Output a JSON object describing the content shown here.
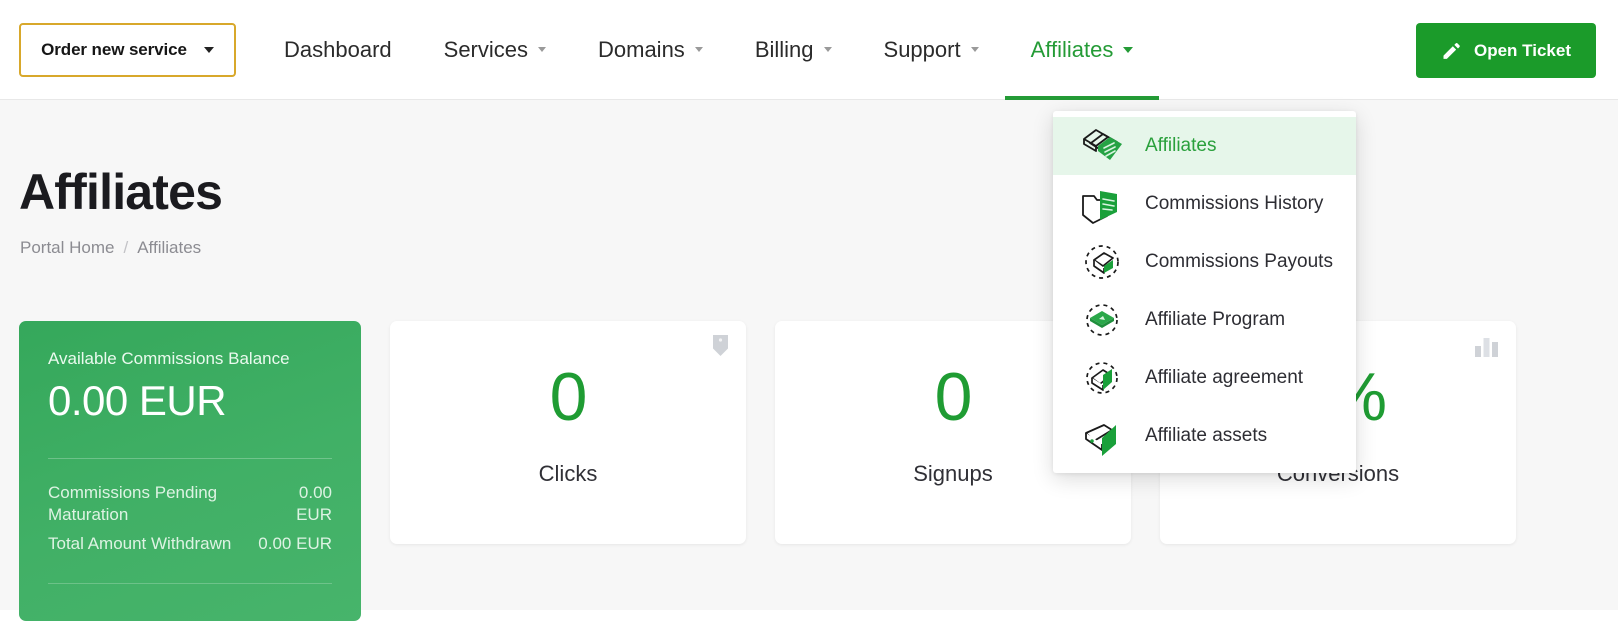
{
  "navbar": {
    "order_button": {
      "label": "Order new service",
      "caret_icon": "chevron-down-icon"
    },
    "items": [
      {
        "label": "Dashboard",
        "has_caret": false,
        "active": false
      },
      {
        "label": "Services",
        "has_caret": true,
        "active": false
      },
      {
        "label": "Domains",
        "has_caret": true,
        "active": false
      },
      {
        "label": "Billing",
        "has_caret": true,
        "active": false
      },
      {
        "label": "Support",
        "has_caret": true,
        "active": false
      },
      {
        "label": "Affiliates",
        "has_caret": true,
        "active": true
      }
    ],
    "open_ticket": {
      "label": "Open Ticket",
      "icon": "pencil-icon"
    }
  },
  "dropdown": {
    "items": [
      {
        "label": "Affiliates",
        "icon": "affiliates-icon",
        "active": true
      },
      {
        "label": "Commissions History",
        "icon": "folder-history-icon",
        "active": false
      },
      {
        "label": "Commissions Payouts",
        "icon": "payouts-dashed-icon",
        "active": false
      },
      {
        "label": "Affiliate Program",
        "icon": "program-diamond-icon",
        "active": false
      },
      {
        "label": "Affiliate agreement",
        "icon": "agreement-dashed-icon",
        "active": false
      },
      {
        "label": "Affiliate assets",
        "icon": "assets-icon",
        "active": false
      }
    ]
  },
  "page": {
    "title": "Affiliates",
    "breadcrumb": {
      "home": "Portal Home",
      "separator": "/",
      "current": "Affiliates"
    }
  },
  "balance_card": {
    "caption": "Available Commissions Balance",
    "amount": "0.00 EUR",
    "rows": [
      {
        "key": "Commissions Pending Maturation",
        "value": "0.00\nEUR"
      },
      {
        "key": "Total Amount Withdrawn",
        "value": "0.00 EUR"
      }
    ]
  },
  "stats": [
    {
      "value": "0",
      "label": "Clicks",
      "icon": "cursor-icon"
    },
    {
      "value": "0",
      "label": "Signups",
      "icon": "none"
    },
    {
      "value": "0%",
      "label": "Conversions",
      "icon": "bar-chart-icon"
    }
  ],
  "colors": {
    "brand_green": "#1b9b2a",
    "accent_green": "#249b36",
    "card_green": "#41b066",
    "order_border": "#d8a82b",
    "page_bg": "#f7f7f7",
    "text_dark": "#2b2b2b",
    "text_muted": "#8c8c92"
  }
}
